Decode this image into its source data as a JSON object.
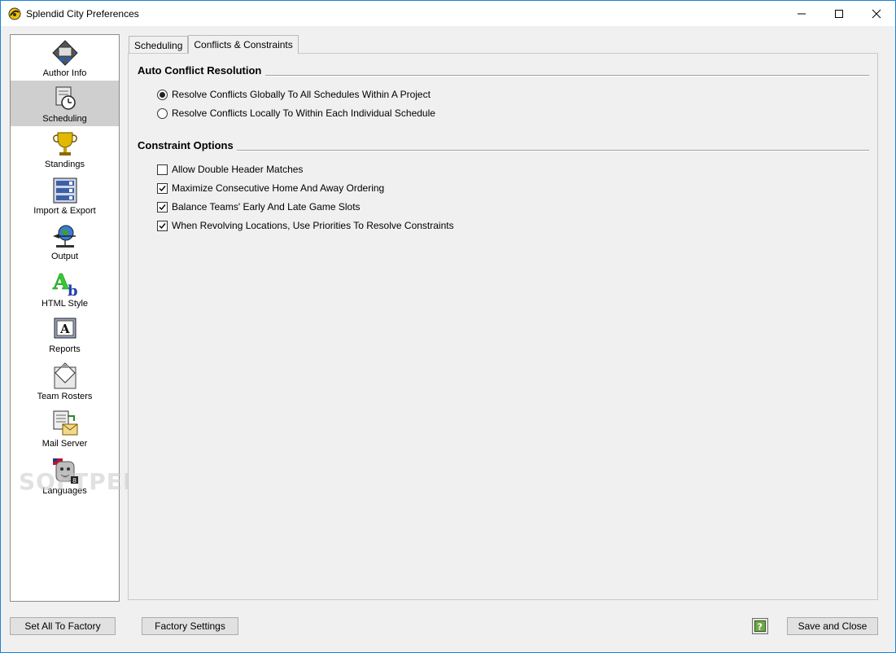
{
  "window": {
    "title": "Splendid City Preferences",
    "minimize_label": "minimize",
    "maximize_label": "maximize",
    "close_label": "close"
  },
  "sidebar": {
    "items": [
      {
        "label": "Author Info",
        "icon": "author-info-icon",
        "selected": false
      },
      {
        "label": "Scheduling",
        "icon": "scheduling-clock-icon",
        "selected": true
      },
      {
        "label": "Standings",
        "icon": "trophy-icon",
        "selected": false
      },
      {
        "label": "Import & Export",
        "icon": "import-export-icon",
        "selected": false
      },
      {
        "label": "Output",
        "icon": "globe-output-icon",
        "selected": false
      },
      {
        "label": "HTML Style",
        "icon": "html-style-icon",
        "selected": false
      },
      {
        "label": "Reports",
        "icon": "reports-icon",
        "selected": false
      },
      {
        "label": "Team Rosters",
        "icon": "team-rosters-icon",
        "selected": false
      },
      {
        "label": "Mail Server",
        "icon": "mail-server-icon",
        "selected": false
      },
      {
        "label": "Languages",
        "icon": "languages-icon",
        "selected": false
      }
    ]
  },
  "tabs": [
    {
      "label": "Scheduling",
      "active": false
    },
    {
      "label": "Conflicts & Constraints",
      "active": true
    }
  ],
  "auto_conflict": {
    "title": "Auto Conflict Resolution",
    "options": [
      {
        "label": "Resolve Conflicts Globally To All Schedules Within A Project",
        "selected": true
      },
      {
        "label": "Resolve Conflicts Locally To Within Each Individual Schedule",
        "selected": false
      }
    ]
  },
  "constraints": {
    "title": "Constraint Options",
    "options": [
      {
        "label": "Allow Double Header Matches",
        "checked": false
      },
      {
        "label": "Maximize Consecutive Home And Away Ordering",
        "checked": true
      },
      {
        "label": "Balance Teams' Early And Late Game Slots",
        "checked": true
      },
      {
        "label": "When Revolving Locations, Use Priorities To Resolve Constraints",
        "checked": true
      }
    ]
  },
  "footer": {
    "set_all_factory": "Set All To Factory",
    "factory_settings": "Factory Settings",
    "save_close": "Save and Close",
    "help_icon": "help-icon"
  },
  "watermark": "SOFTPEDIA",
  "colors": {
    "window_border": "#1883d7",
    "selected_nav": "#cfcfcf",
    "background": "#f0f0f0"
  }
}
